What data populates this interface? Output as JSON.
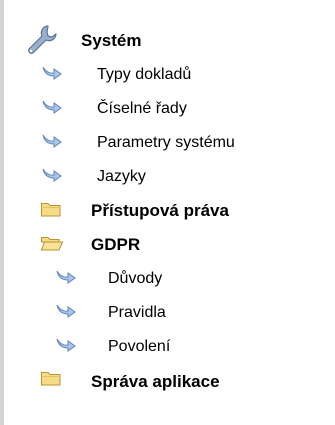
{
  "tree": {
    "root": {
      "label": "Systém",
      "icon": "wrench-icon"
    },
    "items": [
      {
        "label": "Typy dokladů",
        "icon": "arrow-icon",
        "bold": false
      },
      {
        "label": "Číselné řady",
        "icon": "arrow-icon",
        "bold": false
      },
      {
        "label": "Parametry systému",
        "icon": "arrow-icon",
        "bold": false
      },
      {
        "label": "Jazyky",
        "icon": "arrow-icon",
        "bold": false
      },
      {
        "label": "Přístupová práva",
        "icon": "folder-closed-icon",
        "bold": true
      },
      {
        "label": "GDPR",
        "icon": "folder-open-icon",
        "bold": true
      },
      {
        "label": "Důvody",
        "icon": "arrow-icon",
        "bold": false
      },
      {
        "label": "Pravidla",
        "icon": "arrow-icon",
        "bold": false
      },
      {
        "label": "Povolení",
        "icon": "arrow-icon",
        "bold": false
      },
      {
        "label": "Správa aplikace",
        "icon": "folder-closed-icon",
        "bold": true
      }
    ]
  },
  "colors": {
    "arrow_fill": "#a9c6ea",
    "arrow_stroke": "#5f86bb",
    "folder_fill": "#f6dc88",
    "folder_stroke": "#b8952d",
    "wrench": "#7a93b3",
    "border": "#d4d4d4"
  }
}
